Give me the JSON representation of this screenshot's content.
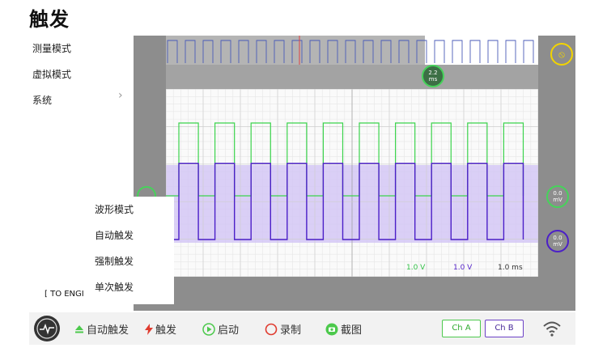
{
  "title": "触发",
  "left_menu": [
    "测量模式",
    "虚拟模式",
    "系统"
  ],
  "scope": {
    "time_probe": {
      "value": "2.2",
      "unit": "ms"
    },
    "channel_a_offset": {
      "value": "0.0",
      "unit": "mV"
    },
    "channel_b_offset": {
      "value": "0.0",
      "unit": "mV"
    },
    "scale_a": "1.0 V",
    "scale_b": "1.0 V",
    "time_scale": "1.0 ms",
    "colors": {
      "channel_a": "#46d35a",
      "channel_b": "#4b1fc8",
      "trigger": "#f2d400",
      "background": "#8d8d8d"
    }
  },
  "trigger_popup": {
    "items": [
      "波形模式",
      "自动触发",
      "强制触发",
      "单次触发"
    ]
  },
  "to_engl_label": "[ TO ENGI",
  "toolbar": {
    "auto_trigger": "自动触发",
    "trigger": "触发",
    "start": "启动",
    "record": "录制",
    "screenshot": "截图",
    "ch_a": "Ch A",
    "ch_b": "Ch B"
  }
}
